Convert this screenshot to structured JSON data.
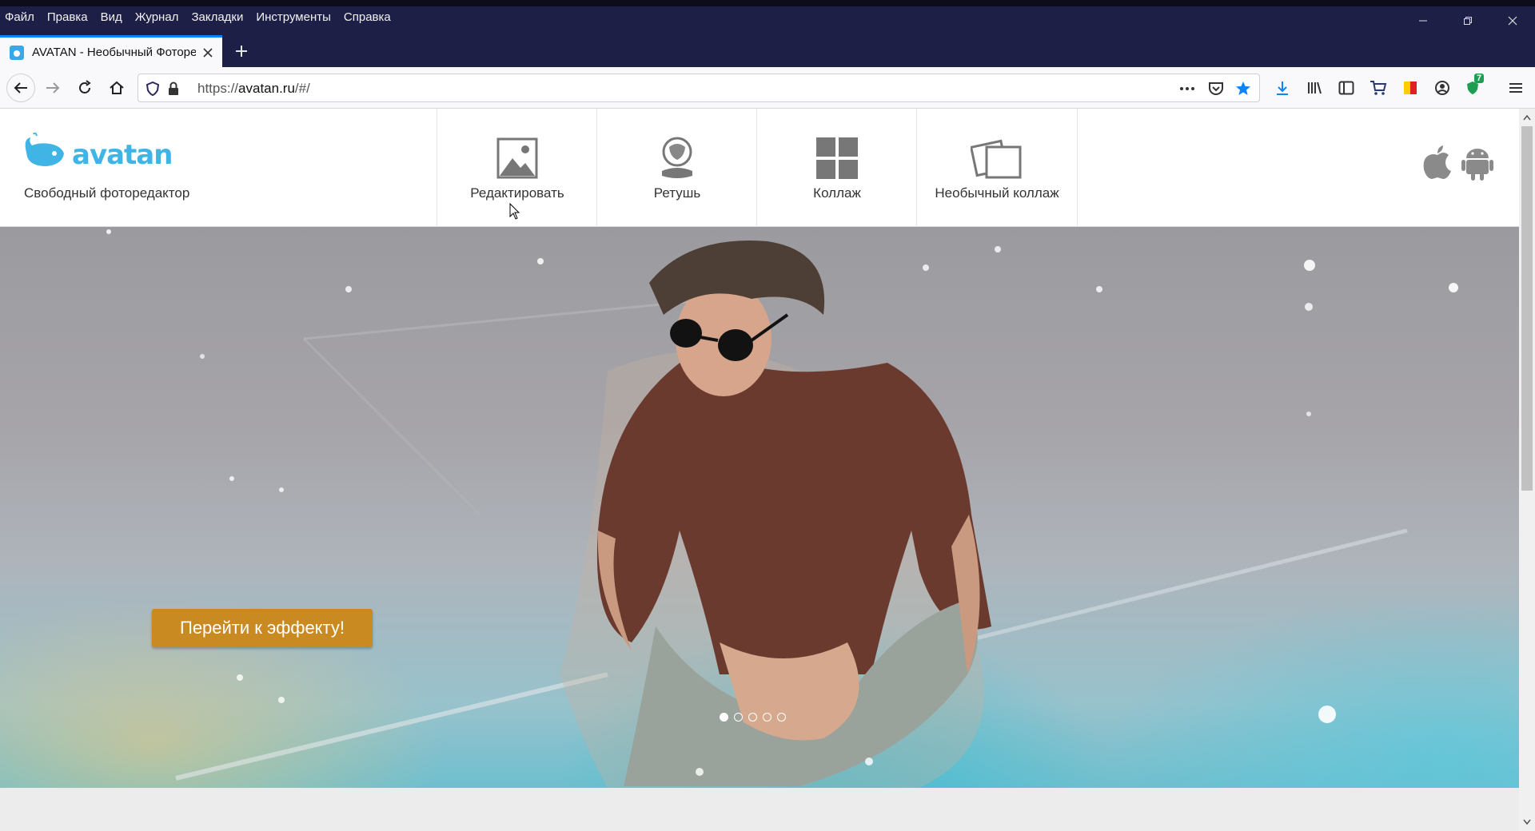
{
  "browser": {
    "menu": [
      "Файл",
      "Правка",
      "Вид",
      "Журнал",
      "Закладки",
      "Инструменты",
      "Справка"
    ],
    "tab_title": "AVATAN - Необычный Фоторедактор",
    "url_prefix": "https://",
    "url_host": "avatan.ru",
    "url_path": "/#/",
    "notification_count": "7",
    "accent": "#0a84ff"
  },
  "site": {
    "logo": "avatan",
    "tagline": "Свободный фоторедактор",
    "nav": [
      {
        "label": "Редактировать",
        "icon": "image-icon"
      },
      {
        "label": "Ретушь",
        "icon": "retouch-icon"
      },
      {
        "label": "Коллаж",
        "icon": "collage-grid-icon"
      },
      {
        "label": "Необычный коллаж",
        "icon": "unusual-collage-icon"
      }
    ],
    "platforms": [
      "apple-icon",
      "android-icon"
    ]
  },
  "hero": {
    "cta_label": "Перейти к эффекту!",
    "slides_total": 5,
    "active_slide": 1,
    "cta_color": "#c98a22"
  }
}
